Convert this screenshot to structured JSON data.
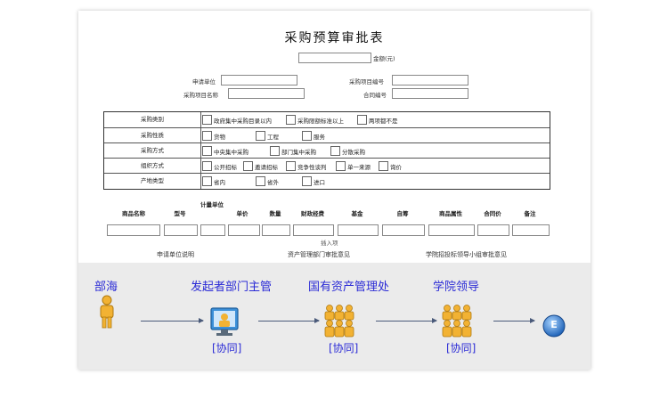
{
  "form": {
    "title": "采购预算审批表",
    "amount_label": "金额(元)",
    "applicant_unit_label": "申请单位",
    "project_name_label": "采购项目名称",
    "project_no_label": "采购项目编号",
    "contract_no_label": "合同编号",
    "sections": [
      {
        "label": "采购类别",
        "options": [
          "政府集中采购目录以内",
          "采购限额标准以上",
          "两项都不是"
        ]
      },
      {
        "label": "采购性质",
        "options": [
          "货物",
          "工程",
          "服务"
        ]
      },
      {
        "label": "采购方式",
        "options": [
          "中央集中采购",
          "部门集中采购",
          "分散采购"
        ]
      },
      {
        "label": "组织方式",
        "options": [
          "公开招标",
          "邀请招标",
          "竞争性谈判",
          "单一来源",
          "询价"
        ]
      },
      {
        "label": "产地类型",
        "options": [
          "省内",
          "省外",
          "进口"
        ]
      }
    ],
    "table_headers": [
      "商品名称",
      "型号",
      "计量单位",
      "单价",
      "数量",
      "财政经费",
      "基金",
      "自筹",
      "商品属性",
      "合同价",
      "备注"
    ],
    "insert_row": "插入项",
    "footer_labels": [
      "申请单位说明",
      "资产管理部门审批意见",
      "学院招投标领导小组审批意见"
    ]
  },
  "flow": {
    "nodes": [
      {
        "label": "部海",
        "tag": ""
      },
      {
        "label": "发起者部门主管",
        "tag": "[协同]"
      },
      {
        "label": "国有资产管理处",
        "tag": "[协同]"
      },
      {
        "label": "学院领导",
        "tag": "[协同]"
      }
    ],
    "end_label": "E",
    "icons": [
      "person-icon",
      "computer-user-icon",
      "group-icon",
      "group-icon",
      "end-node-icon"
    ],
    "colors": {
      "label": "#2b2bd6",
      "person": "#f2b233",
      "end": "#2f7dd8"
    }
  }
}
